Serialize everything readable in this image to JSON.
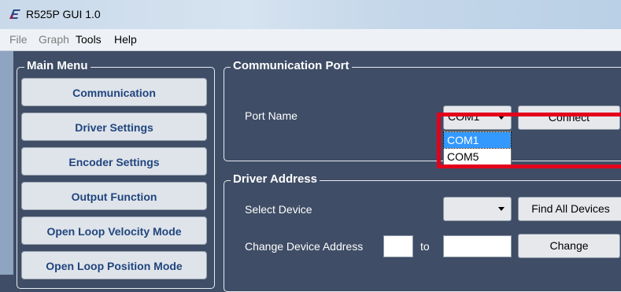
{
  "window": {
    "title": "R525P GUI 1.0",
    "icon": "app-logo-icon"
  },
  "menubar": {
    "items": [
      {
        "label": "File",
        "enabled": false
      },
      {
        "label": "Graph",
        "enabled": false
      },
      {
        "label": "Tools",
        "enabled": true
      },
      {
        "label": "Help",
        "enabled": true
      }
    ]
  },
  "main_menu": {
    "title": "Main Menu",
    "buttons": [
      "Communication",
      "Driver Settings",
      "Encoder Settings",
      "Output Function",
      "Open Loop Velocity Mode",
      "Open Loop Position Mode"
    ]
  },
  "communication_port": {
    "title": "Communication Port",
    "port_label": "Port Name",
    "port_selected": "COM1",
    "connect_label": "Connect",
    "dropdown_options": [
      "COM1",
      "COM5"
    ],
    "dropdown_highlighted": "COM1"
  },
  "driver_address": {
    "title": "Driver Address",
    "select_device_label": "Select Device",
    "select_device_value": "",
    "find_all_label": "Find All Devices",
    "change_address_label": "Change Device Address",
    "from_value": "",
    "to_label": "to",
    "to_value": "",
    "change_label": "Change"
  },
  "colors": {
    "background": "#3f4d66",
    "button_text": "#21457e",
    "highlight_box": "#e3001b",
    "selected_option": "#3399ff"
  }
}
